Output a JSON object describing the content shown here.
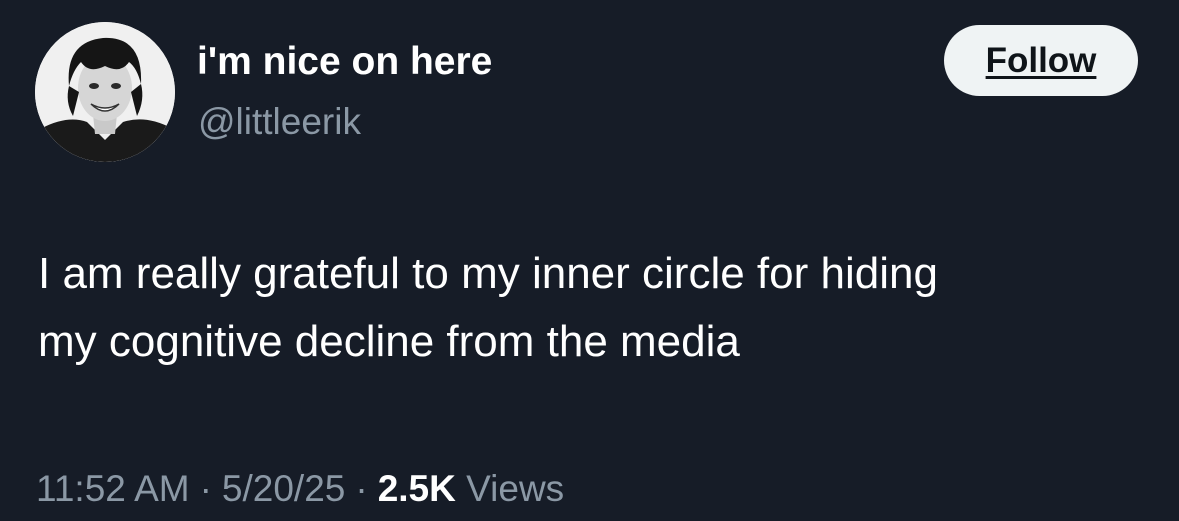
{
  "author": {
    "display_name": "i'm nice on here",
    "handle": "@littleerik",
    "avatar_icon": "profile-photo"
  },
  "follow_button": {
    "label": "Follow"
  },
  "tweet": {
    "text_line1": "I am really grateful to my inner circle for hiding",
    "text_line2": "my cognitive decline from the media"
  },
  "meta": {
    "time": "11:52 AM",
    "separator": "·",
    "date": "5/20/25",
    "views_count": "2.5K",
    "views_label": "Views"
  },
  "colors": {
    "background": "#161c27",
    "text_primary": "#ffffff",
    "text_secondary": "#8b98a5",
    "follow_bg": "#eff3f4"
  }
}
